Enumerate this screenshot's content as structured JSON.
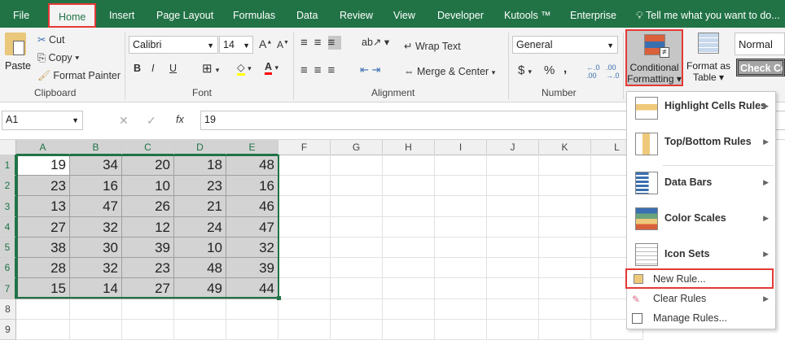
{
  "tabs": [
    {
      "label": "File"
    },
    {
      "label": "Home",
      "active": true
    },
    {
      "label": "Insert"
    },
    {
      "label": "Page Layout"
    },
    {
      "label": "Formulas"
    },
    {
      "label": "Data"
    },
    {
      "label": "Review"
    },
    {
      "label": "View"
    },
    {
      "label": "Developer"
    },
    {
      "label": "Kutools ™"
    },
    {
      "label": "Enterprise"
    }
  ],
  "tell_me": "Tell me what you want to do...",
  "ribbon": {
    "clipboard": {
      "paste": "Paste",
      "cut": "Cut",
      "copy": "Copy",
      "format_painter": "Format Painter",
      "group": "Clipboard"
    },
    "font": {
      "name": "Calibri",
      "size": "14",
      "bold": "B",
      "italic": "I",
      "underline": "U",
      "group": "Font",
      "fill_color": "#ffff00",
      "font_color": "#ff0000"
    },
    "alignment": {
      "wrap": "Wrap Text",
      "merge": "Merge & Center",
      "group": "Alignment"
    },
    "number": {
      "format": "General",
      "currency": "$",
      "percent": "%",
      "comma": ",",
      "group": "Number"
    },
    "styles": {
      "conditional": "Conditional",
      "conditional2": "Formatting",
      "format_table": "Format as",
      "format_table2": "Table",
      "normal": "Normal",
      "check_cell": "Check Ce"
    }
  },
  "formula_bar": {
    "name_box": "A1",
    "fx": "fx",
    "value": "19"
  },
  "columns": [
    "A",
    "B",
    "C",
    "D",
    "E",
    "F",
    "G",
    "H",
    "I",
    "J",
    "K",
    "L"
  ],
  "rows": [
    "1",
    "2",
    "3",
    "4",
    "5",
    "6",
    "7",
    "8",
    "9"
  ],
  "cells": [
    [
      19,
      34,
      20,
      18,
      48
    ],
    [
      23,
      16,
      10,
      23,
      16
    ],
    [
      13,
      47,
      26,
      21,
      46
    ],
    [
      27,
      32,
      12,
      24,
      47
    ],
    [
      38,
      30,
      39,
      10,
      32
    ],
    [
      28,
      32,
      23,
      48,
      39
    ],
    [
      15,
      14,
      27,
      49,
      44
    ]
  ],
  "menu": {
    "items": [
      {
        "label": "Highlight Cells Rules"
      },
      {
        "label": "Top/Bottom Rules"
      },
      {
        "label": "Data Bars"
      },
      {
        "label": "Color Scales"
      },
      {
        "label": "Icon Sets"
      }
    ],
    "new_rule": "New Rule...",
    "clear_rules": "Clear Rules",
    "manage_rules": "Manage Rules..."
  },
  "colors": {
    "accent": "#217346",
    "highlight": "#e53935"
  }
}
